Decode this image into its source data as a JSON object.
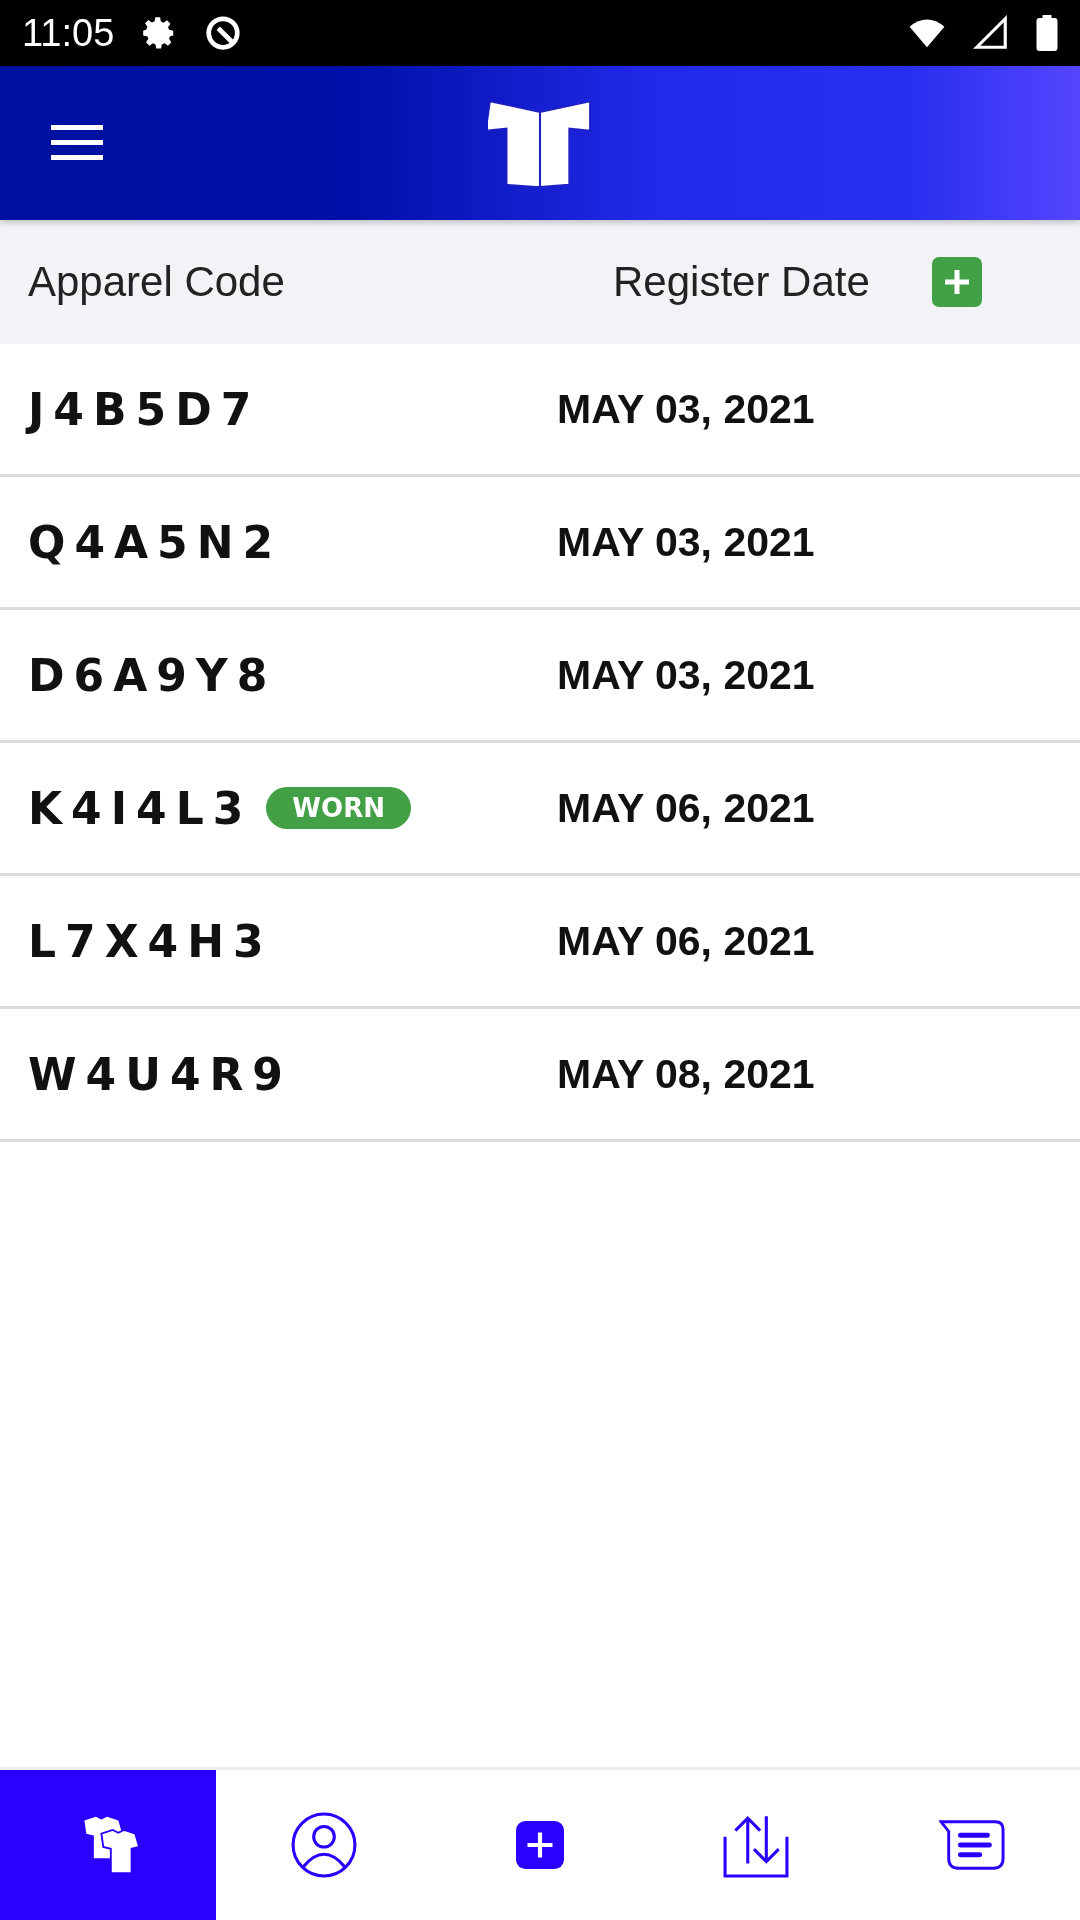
{
  "status_bar": {
    "time": "11:05"
  },
  "table": {
    "columns": [
      "Apparel Code",
      "Register Date"
    ],
    "rows": [
      {
        "code": "J4B5D7",
        "date": "MAY 03, 2021"
      },
      {
        "code": "Q4A5N2",
        "date": "MAY 03, 2021"
      },
      {
        "code": "D6A9Y8",
        "date": "MAY 03, 2021"
      },
      {
        "code": "K4I4L3",
        "badge": "WORN",
        "date": "MAY 06, 2021"
      },
      {
        "code": "L7X4H3",
        "date": "MAY 06, 2021"
      },
      {
        "code": "W4U4R9",
        "date": "MAY 08, 2021"
      }
    ]
  },
  "bottom_nav": [
    {
      "kind": "apparel",
      "selected": true
    },
    {
      "kind": "profile",
      "selected": false
    },
    {
      "kind": "add",
      "selected": false
    },
    {
      "kind": "transfer",
      "selected": false
    },
    {
      "kind": "messages",
      "selected": false
    }
  ]
}
